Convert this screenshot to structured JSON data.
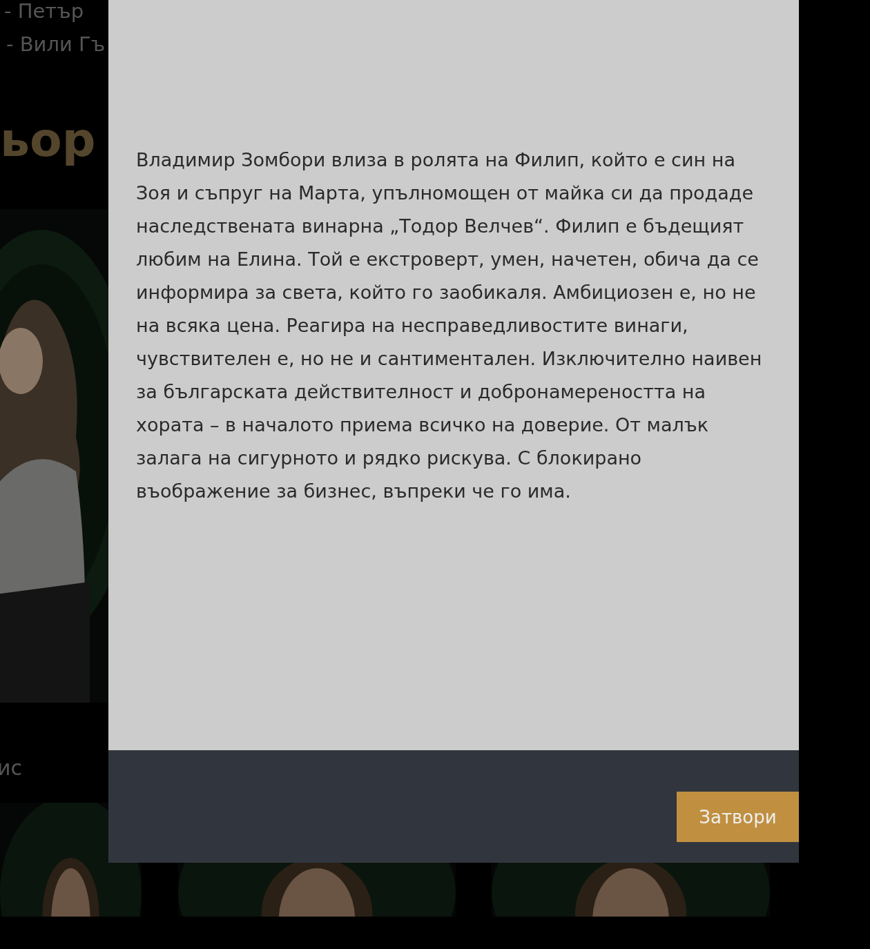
{
  "background": {
    "list_items": [
      "- Петър",
      "- Вили Гъ"
    ],
    "heading": "ьор",
    "caption": "ис"
  },
  "modal": {
    "text": "Владимир Зомбори влиза в ролята на Филип, който е син на Зоя и съпруг на Марта, упълномощен от майка си да продаде наследствената винарна „Тодор Велчев“. Филип е бъдещият любим на Елина. Той е екстроверт, умен, начетен, обича да се информира за света, който го заобикаля. Амбициозен е, но не на всяка цена. Реагира на несправедливостите винаги, чувствителен е, но не и сантиментален. Изключително наивен за българската действителност и добронамереността на хората – в началото приема всичко на доверие. От малък залага на сигурното и рядко рискува. С блокирано въображение за бизнес, въпреки че го има.",
    "close_button": "Затвори"
  }
}
